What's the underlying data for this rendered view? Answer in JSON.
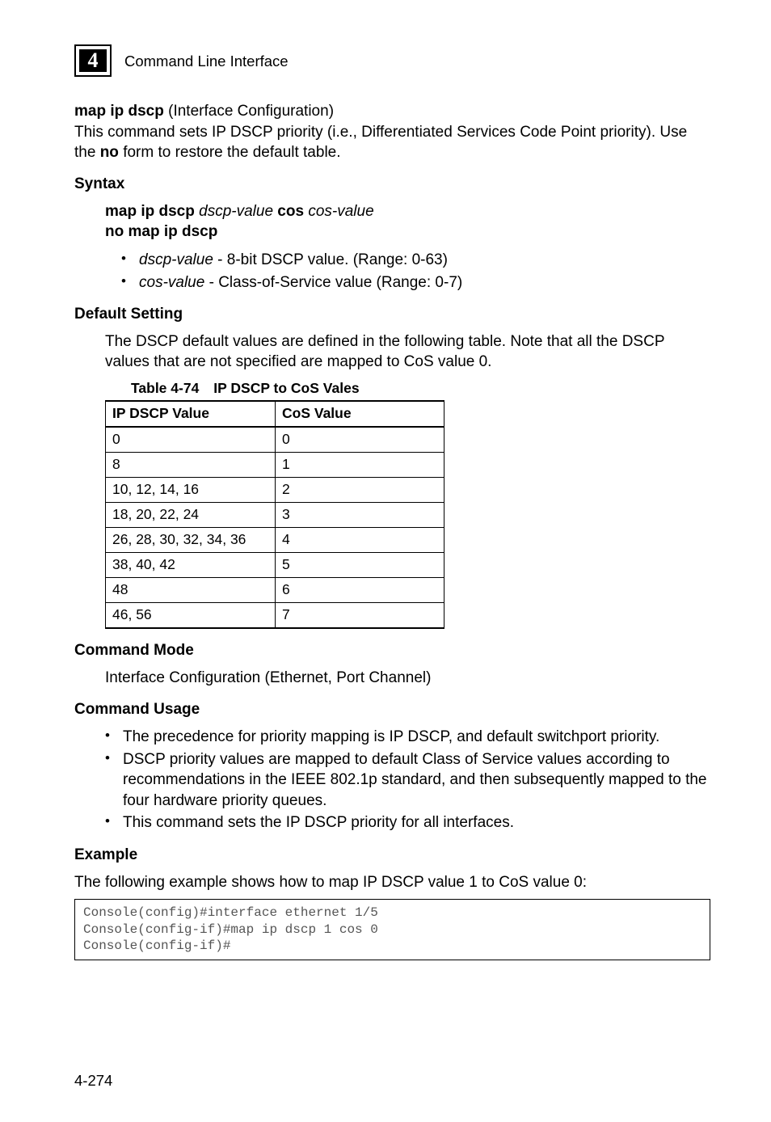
{
  "header": {
    "chapter_number": "4",
    "title": "Command Line Interface"
  },
  "section": {
    "cmd": "map ip dscp",
    "paren": " (Interface Configuration)",
    "desc_pre": "This command sets IP DSCP priority (i.e., Differentiated Services Code Point priority). Use the ",
    "desc_bold": "no",
    "desc_post": " form to restore the default table."
  },
  "syntax": {
    "heading": "Syntax",
    "line1": {
      "p1": "map ip dscp ",
      "i1": "dscp-value",
      "p2": " cos ",
      "i2": "cos-value"
    },
    "line2": "no map ip dscp",
    "bullets": [
      {
        "italic": "dscp-value",
        "rest": " - 8-bit DSCP value. (Range: 0-63)"
      },
      {
        "italic": "cos-value",
        "rest": " - Class-of-Service value (Range: 0-7)"
      }
    ]
  },
  "default_setting": {
    "heading": "Default Setting",
    "text": "The DSCP default values are defined in the following table. Note that all the DSCP values that are not specified are mapped to CoS value 0."
  },
  "table": {
    "label": "Table 4-74",
    "title": "IP DSCP to CoS Vales",
    "col1": "IP DSCP Value",
    "col2": "CoS Value",
    "rows": [
      {
        "dscp": "0",
        "cos": "0"
      },
      {
        "dscp": "8",
        "cos": "1"
      },
      {
        "dscp": "10, 12, 14, 16",
        "cos": "2"
      },
      {
        "dscp": "18, 20, 22, 24",
        "cos": "3"
      },
      {
        "dscp": "26, 28, 30, 32, 34, 36",
        "cos": "4"
      },
      {
        "dscp": "38, 40, 42",
        "cos": "5"
      },
      {
        "dscp": "48",
        "cos": "6"
      },
      {
        "dscp": "46, 56",
        "cos": "7"
      }
    ]
  },
  "command_mode": {
    "heading": "Command Mode",
    "text": "Interface Configuration (Ethernet, Port Channel)"
  },
  "command_usage": {
    "heading": "Command Usage",
    "bullets": [
      "The precedence for priority mapping is IP DSCP, and default switchport priority.",
      "DSCP priority values are mapped to default Class of Service values according to recommendations in the IEEE 802.1p standard, and then subsequently mapped to the four hardware priority queues.",
      "This command sets the IP DSCP priority for all interfaces."
    ]
  },
  "example": {
    "heading": "Example",
    "text": "The following example shows how to map IP DSCP value 1 to CoS value 0:",
    "code": "Console(config)#interface ethernet 1/5\nConsole(config-if)#map ip dscp 1 cos 0\nConsole(config-if)#"
  },
  "page_number": "4-274",
  "chart_data": {
    "type": "table",
    "title": "Table 4-74  IP DSCP to CoS Vales",
    "columns": [
      "IP DSCP Value",
      "CoS Value"
    ],
    "rows": [
      [
        "0",
        0
      ],
      [
        "8",
        1
      ],
      [
        "10, 12, 14, 16",
        2
      ],
      [
        "18, 20, 22, 24",
        3
      ],
      [
        "26, 28, 30, 32, 34, 36",
        4
      ],
      [
        "38, 40, 42",
        5
      ],
      [
        "48",
        6
      ],
      [
        "46, 56",
        7
      ]
    ]
  }
}
